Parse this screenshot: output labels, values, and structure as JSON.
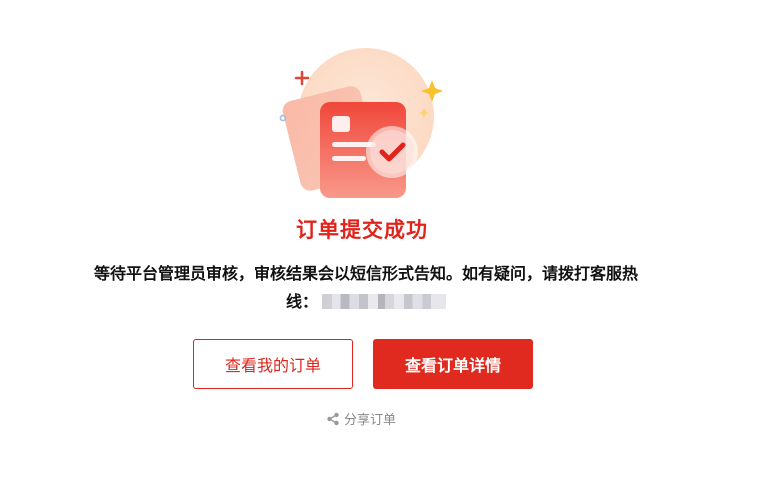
{
  "result": {
    "title": "订单提交成功",
    "notice_text": "等待平台管理员审核，审核结果会以短信形式告知。如有疑问，请拨打客服热线："
  },
  "actions": {
    "view_my_orders_label": "查看我的订单",
    "view_order_detail_label": "查看订单详情",
    "share_label": "分享订单"
  },
  "icons": {
    "illustration": "order-success-illustration",
    "share": "share-icon"
  },
  "colors": {
    "accent": "#e0241c",
    "primary_button_bg": "#e02a1f",
    "muted_text": "#888888"
  }
}
